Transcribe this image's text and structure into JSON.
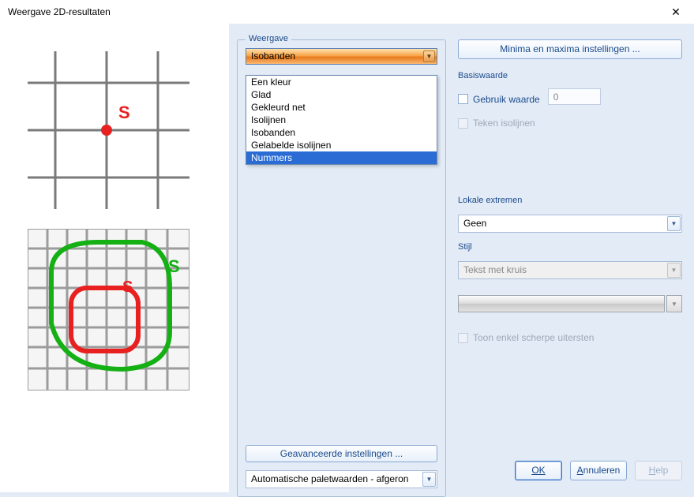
{
  "title": "Weergave 2D-resultaten",
  "weergave": {
    "legend": "Weergave",
    "selected": "Isobanden",
    "options": [
      "Een kleur",
      "Glad",
      "Gekleurd net",
      "Isolijnen",
      "Isobanden",
      "Gelabelde isolijnen",
      "Nummers"
    ],
    "highlight_index": 6,
    "advanced_button": "Geavanceerde instellingen ...",
    "palette_selected": "Automatische paletwaarden - afgeron"
  },
  "right": {
    "minmax_button": "Minima en maxima instellingen ...",
    "basis_label": "Basiswaarde",
    "gebruik_waarde": "Gebruik waarde",
    "basis_value": "0",
    "teken_isolijnen": "Teken isolijnen",
    "lokale_label": "Lokale extremen",
    "lokale_selected": "Geen",
    "stijl_label": "Stijl",
    "stijl_selected": "Tekst met kruis",
    "toon_enkel": "Toon enkel scherpe uitersten"
  },
  "buttons": {
    "ok": "OK",
    "cancel": "Annuleren",
    "help": "Help"
  },
  "previews": {
    "s_label": "S"
  }
}
